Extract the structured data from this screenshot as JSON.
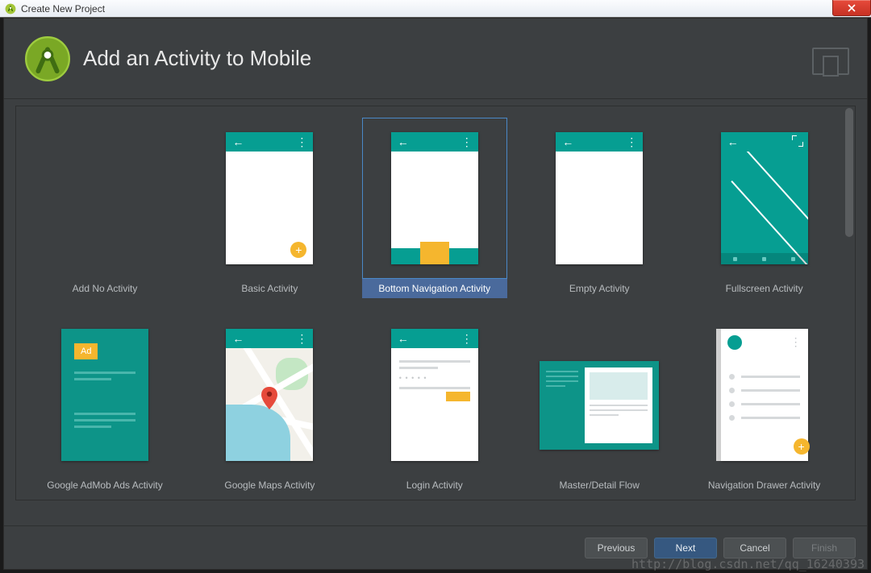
{
  "window": {
    "title": "Create New Project"
  },
  "header": {
    "title": "Add an Activity to Mobile"
  },
  "templates": [
    {
      "label": "Add No Activity",
      "selected": false,
      "kind": "none"
    },
    {
      "label": "Basic Activity",
      "selected": false,
      "kind": "basic"
    },
    {
      "label": "Bottom Navigation Activity",
      "selected": true,
      "kind": "bottomnav"
    },
    {
      "label": "Empty Activity",
      "selected": false,
      "kind": "empty"
    },
    {
      "label": "Fullscreen Activity",
      "selected": false,
      "kind": "fullscreen"
    },
    {
      "label": "Google AdMob Ads Activity",
      "selected": false,
      "kind": "admob"
    },
    {
      "label": "Google Maps Activity",
      "selected": false,
      "kind": "maps"
    },
    {
      "label": "Login Activity",
      "selected": false,
      "kind": "login"
    },
    {
      "label": "Master/Detail Flow",
      "selected": false,
      "kind": "masterdetail"
    },
    {
      "label": "Navigation Drawer Activity",
      "selected": false,
      "kind": "navdrawer"
    }
  ],
  "admob_badge": "Ad",
  "footer": {
    "previous": "Previous",
    "next": "Next",
    "cancel": "Cancel",
    "finish": "Finish"
  },
  "watermark": "http://blog.csdn.net/qq_16240393"
}
